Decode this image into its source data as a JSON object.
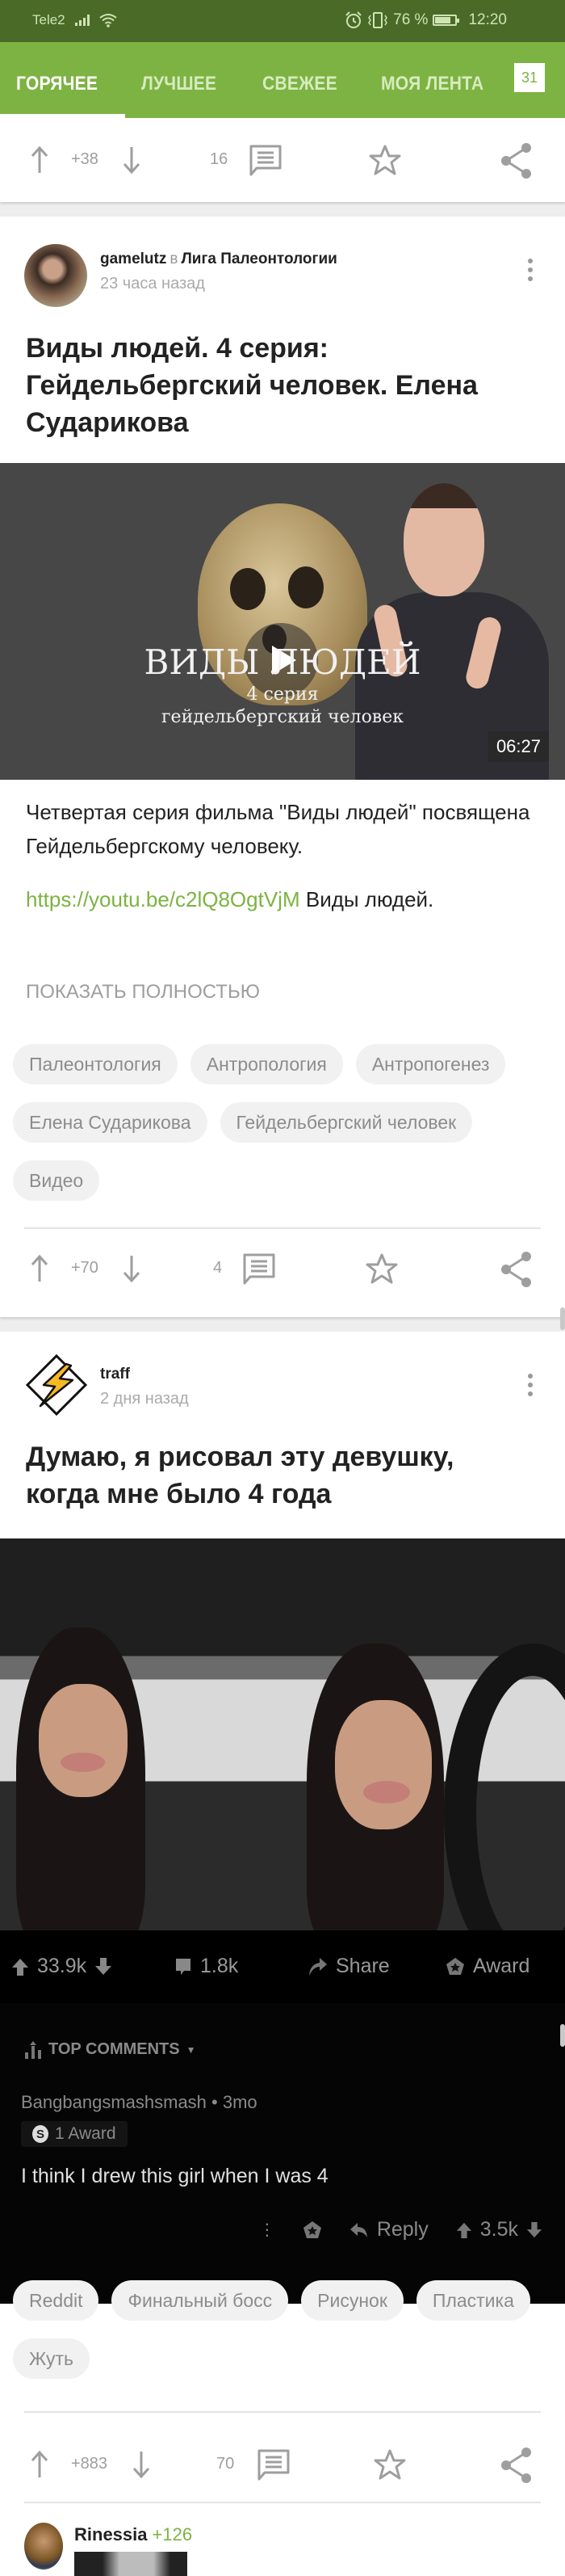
{
  "status_bar": {
    "carrier": "Tele2",
    "battery": "76 %",
    "time": "12:20"
  },
  "tabs": [
    {
      "label": "ГОРЯЧЕЕ",
      "active": true
    },
    {
      "label": "ЛУЧШЕЕ",
      "active": false
    },
    {
      "label": "СВЕЖЕЕ",
      "active": false
    },
    {
      "label": "МОЯ ЛЕНТА",
      "active": false
    }
  ],
  "tab_badge": "31",
  "colors": {
    "brand": "#7cb342",
    "status_bar": "#4a6b27",
    "icon_gray": "#9e9e9e"
  },
  "previous_post_actions": {
    "rating": "+38",
    "comments": "16"
  },
  "posts": [
    {
      "author": "gamelutz",
      "in_word": "в",
      "community": "Лига Палеонтологии",
      "time": "23 часа назад",
      "title": "Виды людей. 4 серия: Гейдельбергский человек. Елена Сударикова",
      "video": {
        "title": "ВИДЫ ЛЮДЕЙ",
        "subtitle": "4 серия",
        "subtitle2": "гейдельбергский человек",
        "duration": "06:27"
      },
      "description": "Четвертая серия фильма \"Виды людей\" посвящена Гейдельбергскому человеку.",
      "link": "https://youtu.be/c2lQ8OgtVjM",
      "link_suffix": " Виды людей.",
      "show_more": "ПОКАЗАТЬ ПОЛНОСТЬЮ",
      "tags": [
        "Палеонтология",
        "Антропология",
        "Антропогенез",
        "Елена Сударикова",
        "Гейдельбергский человек",
        "Видео"
      ],
      "rating": "+70",
      "comments": "4"
    },
    {
      "author": "traff",
      "time": "2 дня назад",
      "title": "Думаю, я рисовал эту девушку, когда мне было 4 года",
      "reddit": {
        "upvotes": "33.9k",
        "comments": "1.8k",
        "share": "Share",
        "award": "Award",
        "sort_label": "TOP COMMENTS",
        "comment": {
          "author_line": "Bangbangsmashsmash • 3mo",
          "award_label": "1 Award",
          "coin": "S",
          "text": "I think I drew this girl when I was 4",
          "reply": "Reply",
          "score": "3.5k"
        }
      },
      "tags": [
        "Reddit",
        "Финальный босс",
        "Рисунок",
        "Пластика",
        "Жуть"
      ],
      "rating": "+883",
      "comments": "70",
      "top_comment": {
        "author": "Rinessia",
        "rating": "+126"
      }
    }
  ]
}
